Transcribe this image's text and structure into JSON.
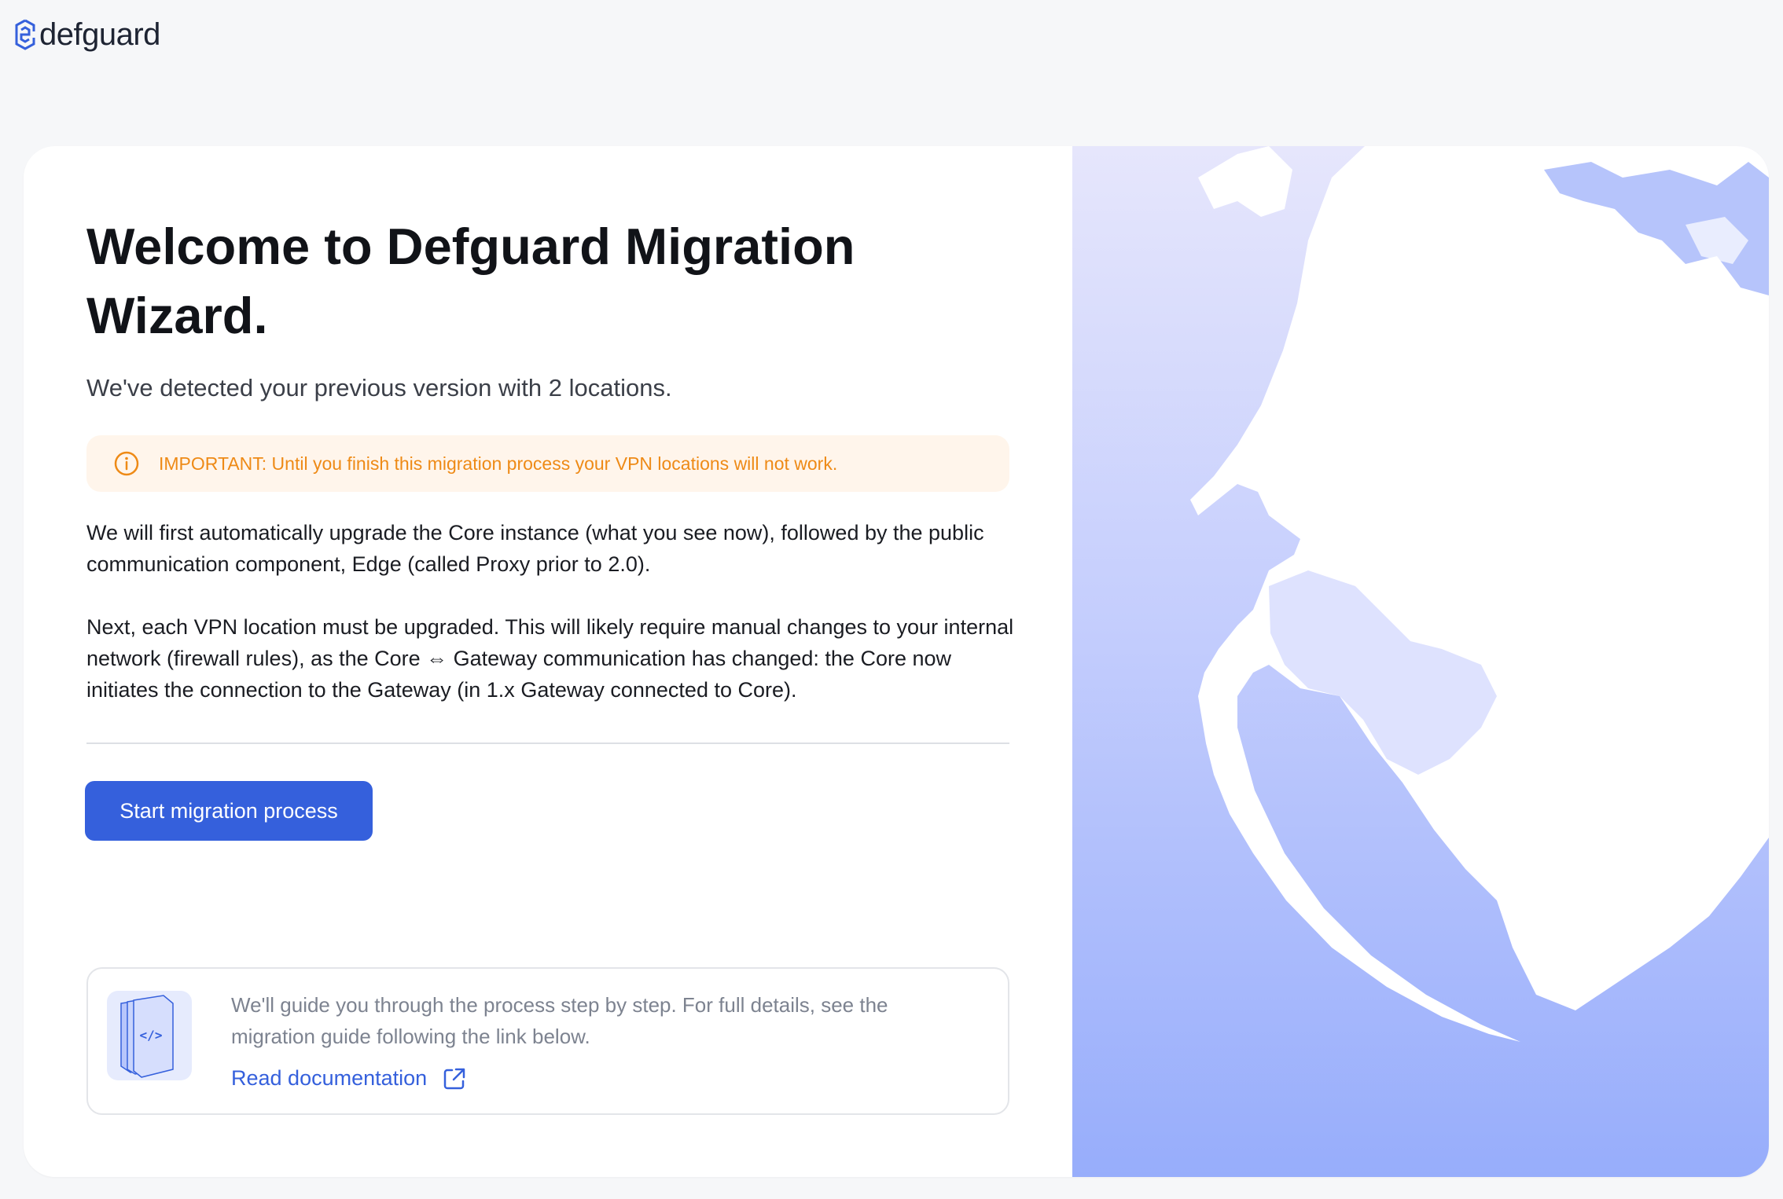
{
  "brand": {
    "name": "defguard",
    "icon": "defguard-logo-icon"
  },
  "wizard": {
    "title": "Welcome to Defguard Migration Wizard.",
    "subtitle": "We've detected your previous version with 2 locations.",
    "alert": {
      "icon": "info-circle-icon",
      "text": "IMPORTANT: Until you finish this migration process your VPN locations will not work.",
      "color": "#ee8a16",
      "background": "#fff5eb"
    },
    "paragraph1": "We will first automatically upgrade the Core instance (what you see now), followed by the public communication component, Edge (called Proxy prior to 2.0).",
    "paragraph2": "Next, each VPN location must be upgraded. This will likely require manual changes to your internal network (firewall rules), as the Core ⇔ Gateway communication has changed: the Core now initiates the connection to the Gateway (in 1.x Gateway connected to Core).",
    "start_button": "Start migration process",
    "accent_color": "#3560dc"
  },
  "guide": {
    "text": "We'll guide you through the process step by step. For full details, see the migration guide following the link below.",
    "link_label": "Read documentation",
    "link_icon": "external-link-icon",
    "illustration_icon": "code-document-icon"
  },
  "illustration": {
    "name": "globe-illustration",
    "icon": "world-map-icon"
  }
}
